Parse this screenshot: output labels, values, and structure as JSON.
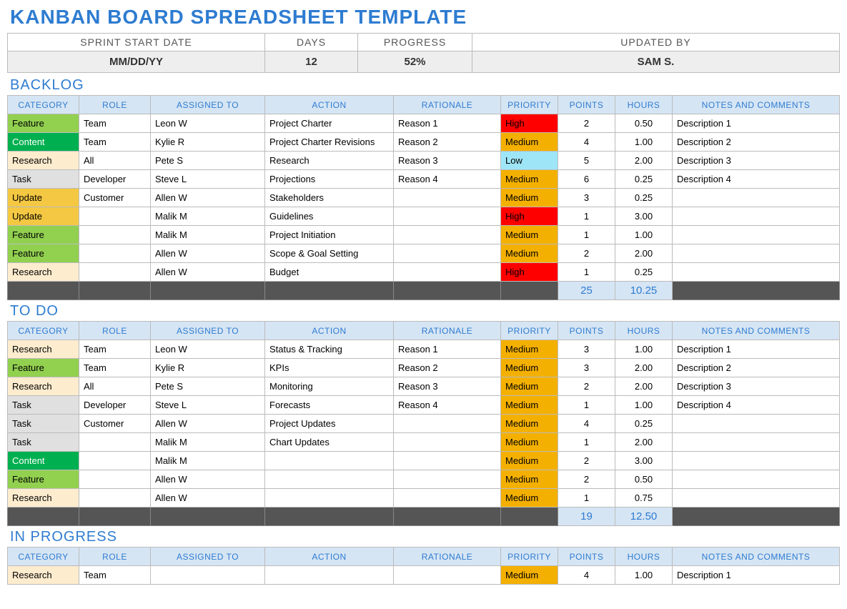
{
  "title": "KANBAN BOARD SPREADSHEET TEMPLATE",
  "summary": {
    "headers": [
      "SPRINT START DATE",
      "DAYS",
      "PROGRESS",
      "UPDATED BY"
    ],
    "values": [
      "MM/DD/YY",
      "12",
      "52%",
      "SAM S."
    ]
  },
  "columns": [
    "CATEGORY",
    "ROLE",
    "ASSIGNED TO",
    "ACTION",
    "RATIONALE",
    "PRIORITY",
    "POINTS",
    "HOURS",
    "NOTES AND COMMENTS"
  ],
  "sections": [
    {
      "title": "BACKLOG",
      "rows": [
        {
          "category": "Feature",
          "role": "Team",
          "assigned": "Leon W",
          "action": "Project Charter",
          "rationale": "Reason 1",
          "priority": "High",
          "points": "2",
          "hours": "0.50",
          "notes": "Description 1"
        },
        {
          "category": "Content",
          "role": "Team",
          "assigned": "Kylie R",
          "action": "Project Charter Revisions",
          "rationale": "Reason 2",
          "priority": "Medium",
          "points": "4",
          "hours": "1.00",
          "notes": "Description 2"
        },
        {
          "category": "Research",
          "role": "All",
          "assigned": "Pete S",
          "action": "Research",
          "rationale": "Reason 3",
          "priority": "Low",
          "points": "5",
          "hours": "2.00",
          "notes": "Description 3"
        },
        {
          "category": "Task",
          "role": "Developer",
          "assigned": "Steve L",
          "action": "Projections",
          "rationale": "Reason 4",
          "priority": "Medium",
          "points": "6",
          "hours": "0.25",
          "notes": "Description 4"
        },
        {
          "category": "Update",
          "role": "Customer",
          "assigned": "Allen W",
          "action": "Stakeholders",
          "rationale": "",
          "priority": "Medium",
          "points": "3",
          "hours": "0.25",
          "notes": ""
        },
        {
          "category": "Update",
          "role": "",
          "assigned": "Malik M",
          "action": "Guidelines",
          "rationale": "",
          "priority": "High",
          "points": "1",
          "hours": "3.00",
          "notes": ""
        },
        {
          "category": "Feature",
          "role": "",
          "assigned": "Malik M",
          "action": "Project Initiation",
          "rationale": "",
          "priority": "Medium",
          "points": "1",
          "hours": "1.00",
          "notes": ""
        },
        {
          "category": "Feature",
          "role": "",
          "assigned": "Allen W",
          "action": "Scope & Goal Setting",
          "rationale": "",
          "priority": "Medium",
          "points": "2",
          "hours": "2.00",
          "notes": ""
        },
        {
          "category": "Research",
          "role": "",
          "assigned": "Allen W",
          "action": "Budget",
          "rationale": "",
          "priority": "High",
          "points": "1",
          "hours": "0.25",
          "notes": ""
        }
      ],
      "totals": {
        "points": "25",
        "hours": "10.25"
      }
    },
    {
      "title": "TO DO",
      "rows": [
        {
          "category": "Research",
          "role": "Team",
          "assigned": "Leon W",
          "action": "Status & Tracking",
          "rationale": "Reason 1",
          "priority": "Medium",
          "points": "3",
          "hours": "1.00",
          "notes": "Description 1"
        },
        {
          "category": "Feature",
          "role": "Team",
          "assigned": "Kylie R",
          "action": "KPIs",
          "rationale": "Reason 2",
          "priority": "Medium",
          "points": "3",
          "hours": "2.00",
          "notes": "Description 2"
        },
        {
          "category": "Research",
          "role": "All",
          "assigned": "Pete S",
          "action": "Monitoring",
          "rationale": "Reason 3",
          "priority": "Medium",
          "points": "2",
          "hours": "2.00",
          "notes": "Description 3"
        },
        {
          "category": "Task",
          "role": "Developer",
          "assigned": "Steve L",
          "action": "Forecasts",
          "rationale": "Reason 4",
          "priority": "Medium",
          "points": "1",
          "hours": "1.00",
          "notes": "Description 4"
        },
        {
          "category": "Task",
          "role": "Customer",
          "assigned": "Allen W",
          "action": "Project Updates",
          "rationale": "",
          "priority": "Medium",
          "points": "4",
          "hours": "0.25",
          "notes": ""
        },
        {
          "category": "Task",
          "role": "",
          "assigned": "Malik M",
          "action": "Chart Updates",
          "rationale": "",
          "priority": "Medium",
          "points": "1",
          "hours": "2.00",
          "notes": ""
        },
        {
          "category": "Content",
          "role": "",
          "assigned": "Malik M",
          "action": "",
          "rationale": "",
          "priority": "Medium",
          "points": "2",
          "hours": "3.00",
          "notes": ""
        },
        {
          "category": "Feature",
          "role": "",
          "assigned": "Allen W",
          "action": "",
          "rationale": "",
          "priority": "Medium",
          "points": "2",
          "hours": "0.50",
          "notes": ""
        },
        {
          "category": "Research",
          "role": "",
          "assigned": "Allen W",
          "action": "",
          "rationale": "",
          "priority": "Medium",
          "points": "1",
          "hours": "0.75",
          "notes": ""
        }
      ],
      "totals": {
        "points": "19",
        "hours": "12.50"
      }
    },
    {
      "title": "IN PROGRESS",
      "rows": [
        {
          "category": "Research",
          "role": "Team",
          "assigned": "",
          "action": "",
          "rationale": "",
          "priority": "Medium",
          "points": "4",
          "hours": "1.00",
          "notes": "Description 1"
        }
      ],
      "totals": null
    }
  ]
}
